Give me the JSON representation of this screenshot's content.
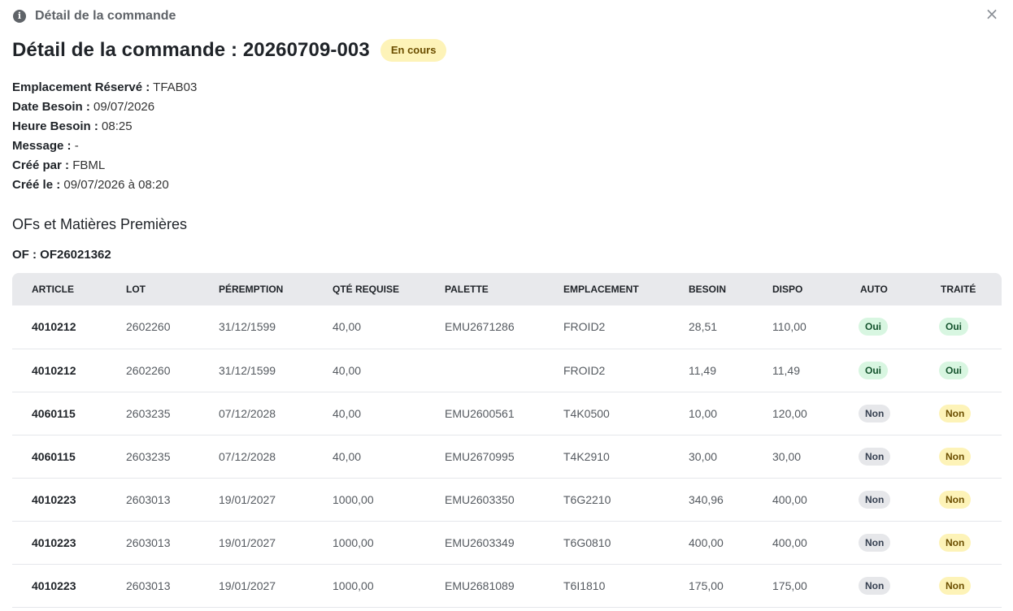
{
  "modal": {
    "title": "Détail de la commande",
    "close_label": "×"
  },
  "page": {
    "title": "Détail de la commande : 20260709-003",
    "status": "En cours"
  },
  "info": [
    {
      "label": "Emplacement Réservé :",
      "value": "TFAB03"
    },
    {
      "label": "Date Besoin :",
      "value": "09/07/2026"
    },
    {
      "label": "Heure Besoin :",
      "value": "08:25"
    },
    {
      "label": "Message :",
      "value": "-"
    },
    {
      "label": "Créé par :",
      "value": "FBML"
    },
    {
      "label": "Créé le :",
      "value": "09/07/2026 à 08:20"
    }
  ],
  "section": {
    "title": "OFs et Matières Premières",
    "of_label": "OF : OF26021362"
  },
  "table": {
    "columns": [
      "ARTICLE",
      "LOT",
      "PÉREMPTION",
      "QTÉ REQUISE",
      "PALETTE",
      "EMPLACEMENT",
      "BESOIN",
      "DISPO",
      "AUTO",
      "TRAITÉ"
    ],
    "rows": [
      {
        "article": "4010212",
        "lot": "2602260",
        "peremption": "31/12/1599",
        "qte": "40,00",
        "palette": "EMU2671286",
        "emplacement": "FROID2",
        "besoin": "28,51",
        "dispo": "110,00",
        "auto": "Oui",
        "traite": "Oui"
      },
      {
        "article": "4010212",
        "lot": "2602260",
        "peremption": "31/12/1599",
        "qte": "40,00",
        "palette": "",
        "emplacement": "FROID2",
        "besoin": "11,49",
        "dispo": "11,49",
        "auto": "Oui",
        "traite": "Oui"
      },
      {
        "article": "4060115",
        "lot": "2603235",
        "peremption": "07/12/2028",
        "qte": "40,00",
        "palette": "EMU2600561",
        "emplacement": "T4K0500",
        "besoin": "10,00",
        "dispo": "120,00",
        "auto": "Non",
        "traite": "Non"
      },
      {
        "article": "4060115",
        "lot": "2603235",
        "peremption": "07/12/2028",
        "qte": "40,00",
        "palette": "EMU2670995",
        "emplacement": "T4K2910",
        "besoin": "30,00",
        "dispo": "30,00",
        "auto": "Non",
        "traite": "Non"
      },
      {
        "article": "4010223",
        "lot": "2603013",
        "peremption": "19/01/2027",
        "qte": "1000,00",
        "palette": "EMU2603350",
        "emplacement": "T6G2210",
        "besoin": "340,96",
        "dispo": "400,00",
        "auto": "Non",
        "traite": "Non"
      },
      {
        "article": "4010223",
        "lot": "2603013",
        "peremption": "19/01/2027",
        "qte": "1000,00",
        "palette": "EMU2603349",
        "emplacement": "T6G0810",
        "besoin": "400,00",
        "dispo": "400,00",
        "auto": "Non",
        "traite": "Non"
      },
      {
        "article": "4010223",
        "lot": "2603013",
        "peremption": "19/01/2027",
        "qte": "1000,00",
        "palette": "EMU2681089",
        "emplacement": "T6I1810",
        "besoin": "175,00",
        "dispo": "175,00",
        "auto": "Non",
        "traite": "Non"
      }
    ]
  },
  "colors": {
    "badge_yes_bg": "#d8f6e1",
    "badge_no_auto_bg": "#e6e7ea",
    "badge_no_traite_bg": "#fdf3b8",
    "status_bg": "#fdf3b8"
  }
}
